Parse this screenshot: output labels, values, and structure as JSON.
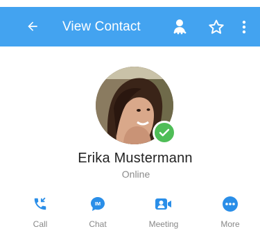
{
  "header": {
    "title": "View Contact",
    "bg_color": "#43a3f0",
    "icons": [
      "back-arrow-icon",
      "presenter-icon",
      "star-outline-icon",
      "more-vert-icon"
    ]
  },
  "contact": {
    "name": "Erika Mustermann",
    "status": "Online",
    "status_color": "#4fbd57"
  },
  "actions": [
    {
      "label": "Call",
      "icon": "phone-callback-icon"
    },
    {
      "label": "Chat",
      "icon": "chat-bubble-icon"
    },
    {
      "label": "Meeting",
      "icon": "video-camera-icon"
    },
    {
      "label": "More",
      "icon": "more-horiz-icon"
    }
  ],
  "accent_color": "#2a8ee8"
}
